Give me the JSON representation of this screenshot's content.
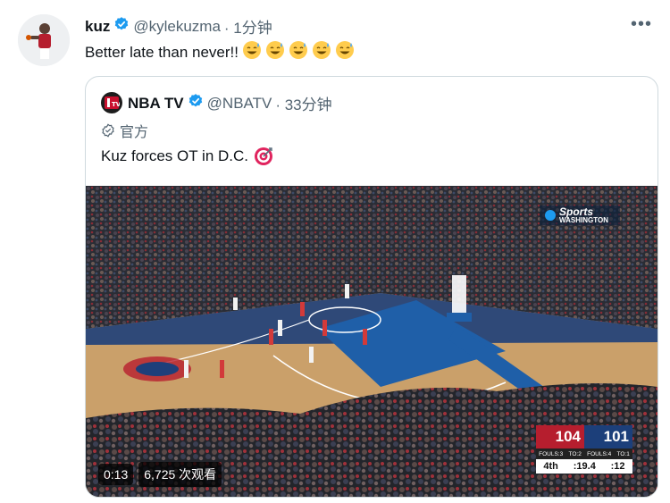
{
  "tweet": {
    "name": "kuz",
    "handle": "@kylekuzma",
    "time": "· 1分钟",
    "text": "Better late than never!!",
    "emojis": 5
  },
  "quoted": {
    "name": "NBA TV",
    "handle": "@NBATV",
    "time": "· 33分钟",
    "official_label": "官方",
    "text": "Kuz forces OT in D.C."
  },
  "video": {
    "elapsed": "0:13",
    "views": "6,725 次观看",
    "broadcast": {
      "network": "Sports",
      "region": "WASHINGTON"
    },
    "scoreboard": {
      "home_score": "104",
      "away_score": "101",
      "home_fouls": "FOULS:3",
      "home_to": "TO:2",
      "away_fouls": "FOULS:4",
      "away_to": "TO:1",
      "quarter": "4th",
      "clock": ":19.4",
      "shot_clock": ":12"
    }
  },
  "colors": {
    "verified": "#1d9bf0",
    "muted": "#536471",
    "court": "#c9a26b",
    "paint": "#1f5fa8",
    "home_red": "#b61e2e",
    "away_blue": "#1c3f7a"
  }
}
